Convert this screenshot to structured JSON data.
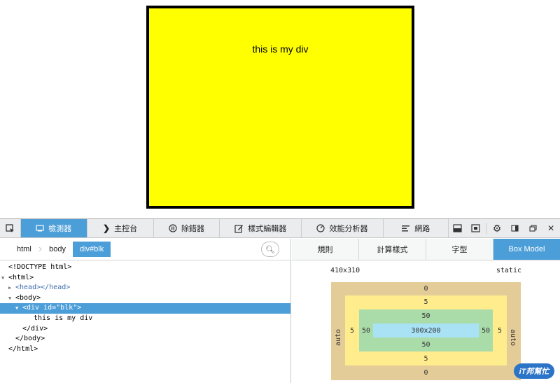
{
  "page": {
    "div_text": "this is my div",
    "div_color": "#ffff00"
  },
  "toolbar": {
    "tabs": [
      {
        "label": "檢測器",
        "icon": "inspector-icon",
        "active": true
      },
      {
        "label": "主控台",
        "icon": "console-icon",
        "active": false
      },
      {
        "label": "除錯器",
        "icon": "debugger-icon",
        "active": false
      },
      {
        "label": "樣式編輯器",
        "icon": "style-editor-icon",
        "active": false
      },
      {
        "label": "效能分析器",
        "icon": "profiler-icon",
        "active": false
      },
      {
        "label": "網路",
        "icon": "network-icon",
        "active": false
      }
    ]
  },
  "breadcrumbs": [
    "html",
    "body",
    "div#blk"
  ],
  "markup_tree": [
    "<!DOCTYPE html>",
    "<html>",
    "<head></head>",
    "<body>",
    "<div id=\"blk\">",
    "this is my div",
    "</div>",
    "</body>",
    "</html>"
  ],
  "sidebar_tabs": [
    "規則",
    "計算樣式",
    "字型",
    "Box Model"
  ],
  "box_model": {
    "dimensions": "410x310",
    "position": "static",
    "margin": {
      "top": "0",
      "right": "auto",
      "bottom": "0",
      "left": "auto"
    },
    "border": {
      "top": "5",
      "right": "5",
      "bottom": "5",
      "left": "5"
    },
    "padding": {
      "top": "50",
      "right": "50",
      "bottom": "50",
      "left": "50"
    },
    "content": "300x200"
  },
  "colors": {
    "accent": "#4c9ed9",
    "margin": "#e3cc97",
    "border": "#ffec8c",
    "padding": "#aadcaa",
    "content": "#a8e2f4"
  },
  "watermark": "iT邦幫忙"
}
